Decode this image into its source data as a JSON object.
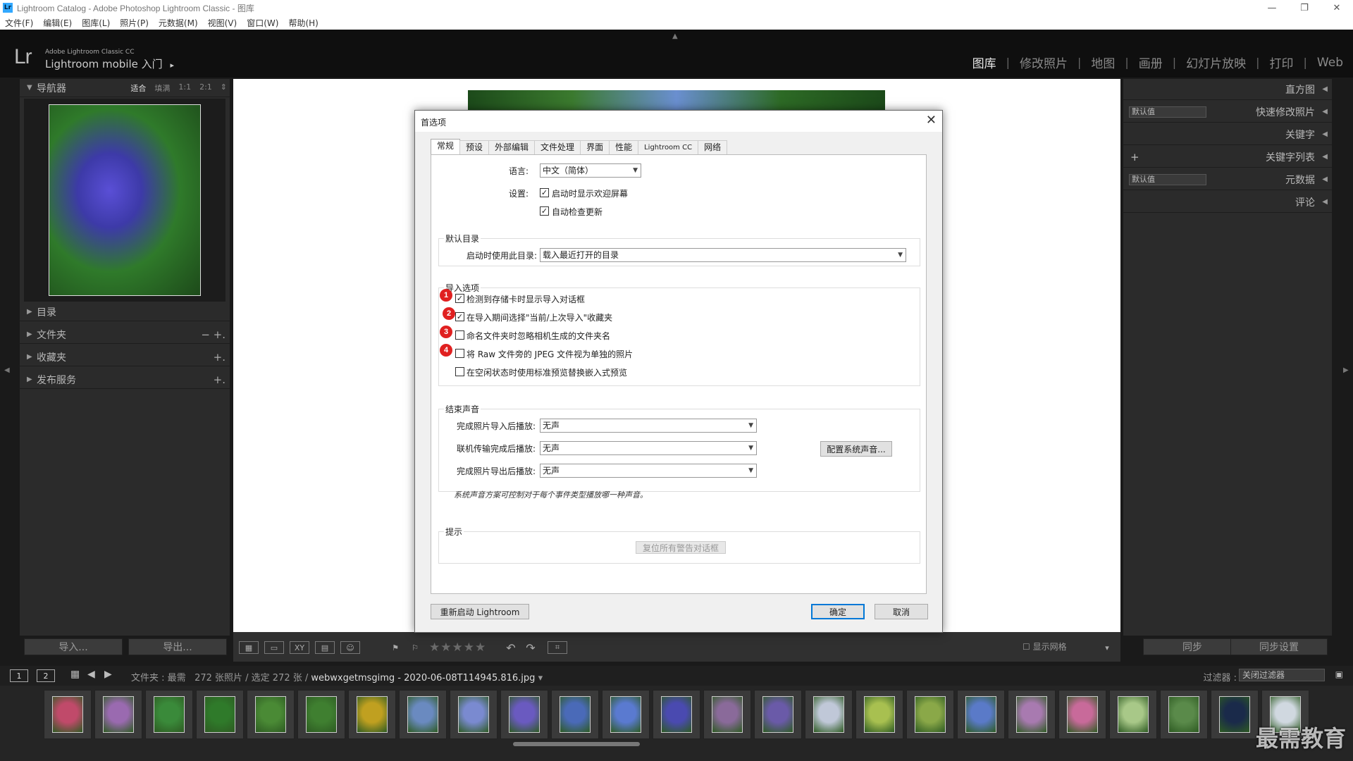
{
  "window": {
    "title": "Lightroom Catalog - Adobe Photoshop Lightroom Classic - 图库",
    "app_icon": "Lr",
    "controls": [
      "—",
      "❐",
      "✕"
    ]
  },
  "menu": [
    "文件(F)",
    "编辑(E)",
    "图库(L)",
    "照片(P)",
    "元数据(M)",
    "视图(V)",
    "窗口(W)",
    "帮助(H)"
  ],
  "header": {
    "logo": "Lr",
    "brand": "Adobe Lightroom Classic CC",
    "subtitle": "Lightroom mobile 入门",
    "subtitle_arrow": "▸",
    "modules": [
      "图库",
      "修改照片",
      "地图",
      "画册",
      "幻灯片放映",
      "打印",
      "Web"
    ],
    "separator": "|",
    "active_module": "图库"
  },
  "left_panel": {
    "navigator": {
      "title": "导航器",
      "options": [
        "适合",
        "填满",
        "1:1",
        "2:1"
      ],
      "active_option": "适合",
      "spin": "⇕"
    },
    "sections": [
      {
        "title": "目录",
        "actions": ""
      },
      {
        "title": "文件夹",
        "actions": "−  +."
      },
      {
        "title": "收藏夹",
        "actions": "+."
      },
      {
        "title": "发布服务",
        "actions": "+."
      }
    ],
    "import_label": "导入...",
    "export_label": "导出..."
  },
  "right_panel": {
    "rows": [
      {
        "title": "直方图",
        "dropdown": "",
        "plus": ""
      },
      {
        "title": "快速修改照片",
        "dropdown": "默认值",
        "plus": ""
      },
      {
        "title": "关键字",
        "dropdown": "",
        "plus": ""
      },
      {
        "title": "关键字列表",
        "dropdown": "",
        "plus": "+"
      },
      {
        "title": "元数据",
        "dropdown": "默认值",
        "plus": ""
      },
      {
        "title": "评论",
        "dropdown": "",
        "plus": ""
      }
    ],
    "sync_label": "同步",
    "sync_settings_label": "同步设置"
  },
  "toolbar": {
    "stars": "★★★★★",
    "show_grid_label": "显示网格"
  },
  "filmstrip_bar": {
    "pages": [
      "1",
      "2"
    ],
    "path_prefix": "文件夹 : 最需",
    "path_count": "272 张照片 / 选定 272 张 /",
    "path_file": "webwxgetmsgimg - 2020-06-08T114945.816.jpg",
    "path_arrow": "▾",
    "filter_label": "过滤器 :",
    "filter_value": "关闭过滤器"
  },
  "filmstrip": {
    "thumb_colors": [
      "#c04a6a",
      "#9a6ab0",
      "#3a8a3a",
      "#2f7a2a",
      "#4a8a35",
      "#3f7f30",
      "#c0a020",
      "#6a8ac0",
      "#7a8ad0",
      "#6a5ac0",
      "#4a6ab8",
      "#5a7ad0",
      "#4a4ab0",
      "#8a6a9a",
      "#6a5aa8",
      "#c0c8d8",
      "#a8c050",
      "#8aa848",
      "#5a7ac8",
      "#a87ab0",
      "#c86a9a",
      "#a8c888",
      "#5a8a4a",
      "#1a2a4a",
      "#d0d8e0"
    ],
    "watermark": "最需教育"
  },
  "dialog": {
    "title": "首选项",
    "close": "✕",
    "tabs": [
      "常规",
      "预设",
      "外部编辑",
      "文件处理",
      "界面",
      "性能",
      "Lightroom CC",
      "网络"
    ],
    "active_tab": "常规",
    "language_label": "语言:",
    "language_value": "中文（简体）",
    "settings_label": "设置:",
    "show_splash": "启动时显示欢迎屏幕",
    "auto_update": "自动检查更新",
    "default_catalog": {
      "title": "默认目录",
      "label": "启动时使用此目录:",
      "value": "载入最近打开的目录"
    },
    "import_options": {
      "title": "导入选项",
      "items": [
        {
          "label": "检测到存储卡时显示导入对话框",
          "checked": "☑",
          "badge": "1"
        },
        {
          "label": "在导入期间选择\"当前/上次导入\"收藏夹",
          "checked": "☑",
          "badge": "2"
        },
        {
          "label": "命名文件夹时忽略相机生成的文件夹名",
          "checked": "",
          "badge": "3"
        },
        {
          "label": "将 Raw 文件旁的 JPEG 文件视为单独的照片",
          "checked": "",
          "badge": "4"
        },
        {
          "label": "在空闲状态时使用标准预览替换嵌入式预览",
          "checked": "",
          "badge": ""
        }
      ]
    },
    "sounds": {
      "title": "结束声音",
      "rows": [
        {
          "label": "完成照片导入后播放:",
          "value": "无声"
        },
        {
          "label": "联机传输完成后播放:",
          "value": "无声"
        },
        {
          "label": "完成照片导出后播放:",
          "value": "无声"
        }
      ],
      "config_button": "配置系统声音...",
      "note": "系统声音方案可控制对于每个事件类型播放哪一种声音。"
    },
    "tips": {
      "title": "提示",
      "reset_button": "复位所有警告对话框"
    },
    "restart_button": "重新启动 Lightroom",
    "ok_button": "确定",
    "cancel_button": "取消"
  }
}
